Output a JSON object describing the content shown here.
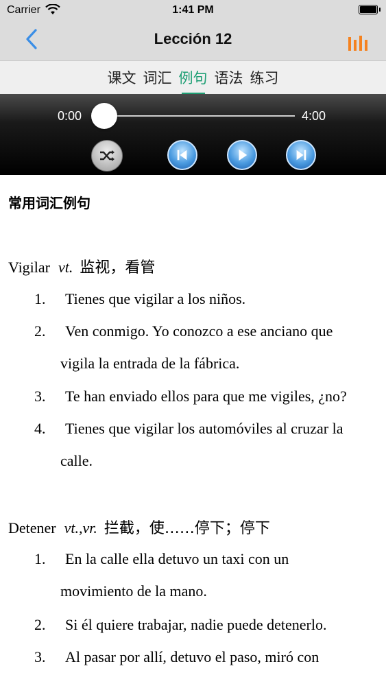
{
  "status": {
    "carrier": "Carrier",
    "time": "1:41 PM"
  },
  "nav": {
    "title": "Lección 12"
  },
  "tabs": [
    {
      "label": "课文",
      "active": false
    },
    {
      "label": "词汇",
      "active": false
    },
    {
      "label": "例句",
      "active": true
    },
    {
      "label": "语法",
      "active": false
    },
    {
      "label": "练习",
      "active": false
    }
  ],
  "player": {
    "current_time": "0:00",
    "duration": "4:00",
    "progress": 0
  },
  "content": {
    "section_title": "常用词汇例句",
    "entries": [
      {
        "word": "Vigilar",
        "pos": "vt.",
        "meaning": "监视，看管",
        "examples": [
          {
            "num": "1.",
            "text": "Tienes que vigilar a los niños.",
            "cont": ""
          },
          {
            "num": "2.",
            "text": "Ven conmigo. Yo conozco a ese anciano que",
            "cont": "vigila la entrada de la fábrica."
          },
          {
            "num": "3.",
            "text": "Te han enviado ellos para que me vigiles, ¿no?",
            "cont": ""
          },
          {
            "num": "4.",
            "text": "Tienes que vigilar los automóviles al cruzar la",
            "cont": "calle."
          }
        ]
      },
      {
        "word": "Detener",
        "pos": "vt.,vr.",
        "meaning": "拦截，使……停下；停下",
        "examples": [
          {
            "num": "1.",
            "text": "En la calle ella detuvo un taxi con un",
            "cont": "movimiento de la mano."
          },
          {
            "num": "2.",
            "text": "Si él quiere trabajar, nadie puede detenerlo.",
            "cont": ""
          },
          {
            "num": "3.",
            "text": "Al pasar por allí, detuvo el paso, miró con",
            "cont": ""
          }
        ]
      }
    ]
  },
  "colors": {
    "accent_green": "#1e9f74",
    "back_blue": "#3a8ee6",
    "bars_orange": "#f5821f"
  }
}
